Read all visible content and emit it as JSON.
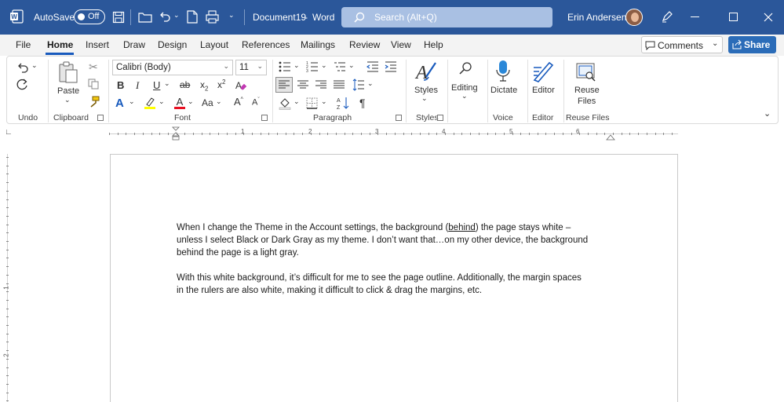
{
  "titlebar": {
    "autosave_label": "AutoSave",
    "autosave_state": "Off",
    "document_name": "Document19",
    "separator": "-",
    "app_name": "Word",
    "search_placeholder": "Search (Alt+Q)",
    "user_name": "Erin Andersen"
  },
  "menu": {
    "tabs": [
      "File",
      "Home",
      "Insert",
      "Draw",
      "Design",
      "Layout",
      "References",
      "Mailings",
      "Review",
      "View",
      "Help"
    ],
    "active": "Home",
    "comments_label": "Comments",
    "share_label": "Share"
  },
  "ribbon": {
    "groups": {
      "undo": "Undo",
      "clipboard": "Clipboard",
      "font": "Font",
      "paragraph": "Paragraph",
      "styles": "Styles",
      "voice": "Voice",
      "editor": "Editor",
      "reuse_files": "Reuse Files"
    },
    "paste_label": "Paste",
    "font_name": "Calibri (Body)",
    "font_size": "11",
    "styles_label": "Styles",
    "editing_label": "Editing",
    "dictate_label": "Dictate",
    "editor_label": "Editor",
    "reuse_label_line1": "Reuse",
    "reuse_label_line2": "Files"
  },
  "ruler": {
    "h_numbers": [
      "1",
      "2",
      "3",
      "4",
      "5",
      "6"
    ],
    "v_numbers": [
      "1",
      "2"
    ]
  },
  "document": {
    "para1_line1_a": "When I change the Theme in the Account settings, the background (",
    "para1_line1_u": "behind",
    "para1_line1_b": ") the page stays white –",
    "para1_line2": "unless I select Black or Dark Gray as my theme.  I don’t want that…on my other device, the background",
    "para1_line3": "behind the page is a light gray.",
    "para2_line1": "With this white background, it’s difficult for me to see the page outline.  Additionally, the margin spaces",
    "para2_line2": "in the rulers are also white, making it difficult to click & drag the margins, etc."
  },
  "colors": {
    "titlebar": "#2b579a",
    "accent": "#185abd",
    "share": "#2b6cb8",
    "font_color_red": "#e81123",
    "highlight_yellow": "#ffff00"
  }
}
